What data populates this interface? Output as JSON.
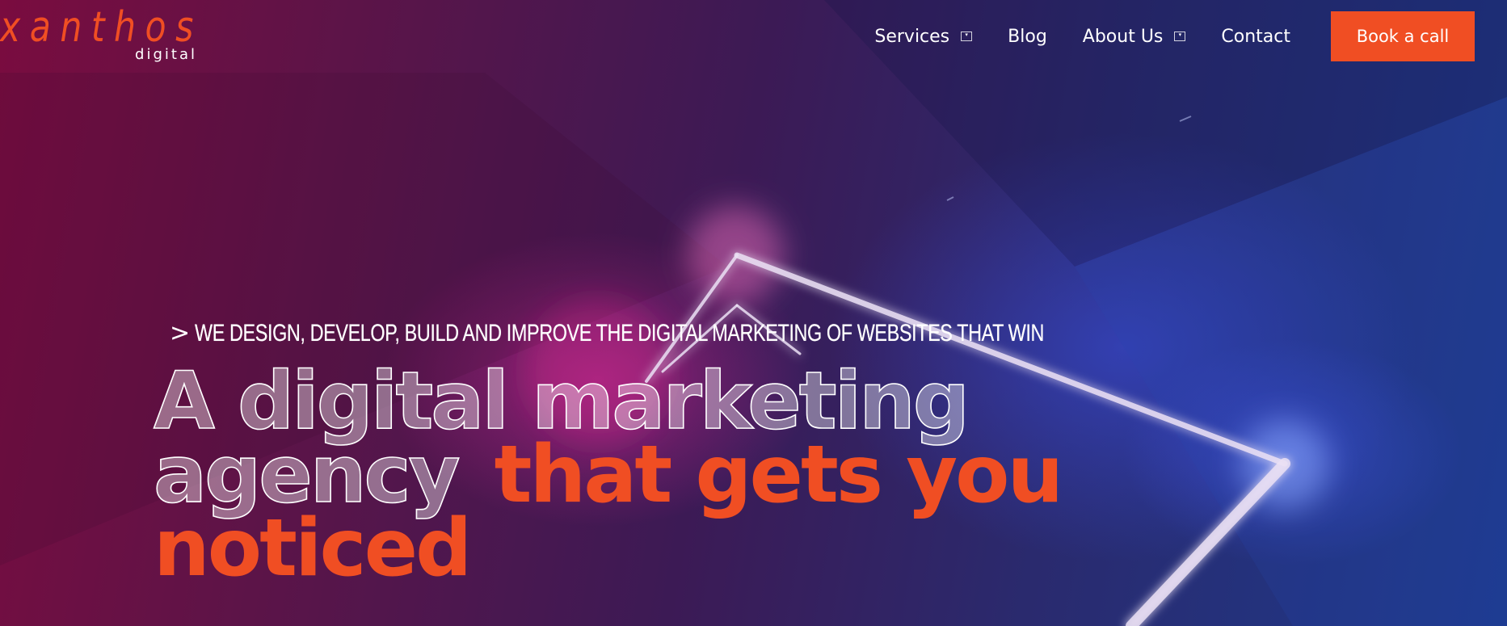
{
  "brand": {
    "name": "xanthos",
    "sub": "digital"
  },
  "nav": {
    "items": [
      {
        "label": "Services",
        "has_dropdown": true
      },
      {
        "label": "Blog",
        "has_dropdown": false
      },
      {
        "label": "About Us",
        "has_dropdown": true
      },
      {
        "label": "Contact",
        "has_dropdown": false
      }
    ],
    "cta": "Book a call"
  },
  "hero": {
    "tagline": "WE DESIGN, DEVELOP, BUILD AND IMPROVE THE DIGITAL MARKETING OF WEBSITES THAT WIN",
    "headline_line1": "A digital marketing",
    "headline_line2_outline": "agency",
    "headline_line2_accent": "that gets you",
    "headline_line3_accent": "noticed"
  },
  "colors": {
    "accent": "#f04e23",
    "text": "#ffffff"
  }
}
